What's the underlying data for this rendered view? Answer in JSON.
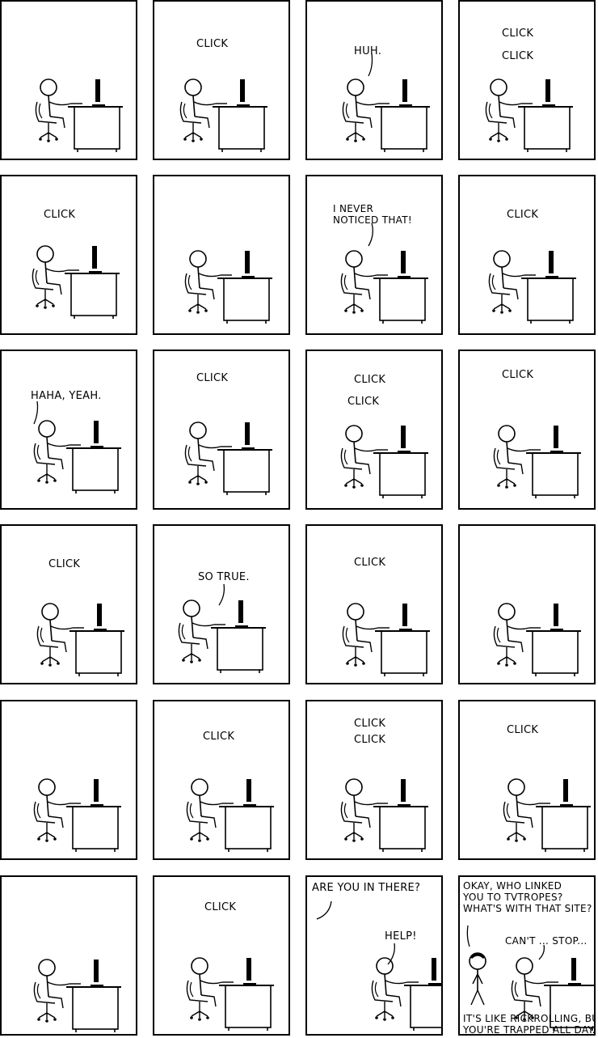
{
  "comic": {
    "panels": [
      {
        "id": 1,
        "lines": []
      },
      {
        "id": 2,
        "lines": [
          "CLICK"
        ]
      },
      {
        "id": 3,
        "lines": [
          "HUH."
        ]
      },
      {
        "id": 4,
        "lines": [
          "CLICK",
          "CLICK"
        ]
      },
      {
        "id": 5,
        "lines": [
          "CLICK"
        ]
      },
      {
        "id": 6,
        "lines": []
      },
      {
        "id": 7,
        "lines": [
          "I NEVER",
          "NOTICED THAT!"
        ]
      },
      {
        "id": 8,
        "lines": [
          "CLICK"
        ]
      },
      {
        "id": 9,
        "lines": [
          "HAHA, YEAH."
        ]
      },
      {
        "id": 10,
        "lines": [
          "CLICK"
        ]
      },
      {
        "id": 11,
        "lines": [
          "CLICK",
          "CLICK"
        ]
      },
      {
        "id": 12,
        "lines": [
          "CLICK"
        ]
      },
      {
        "id": 13,
        "lines": [
          "CLICK"
        ]
      },
      {
        "id": 14,
        "lines": [
          "SO TRUE."
        ]
      },
      {
        "id": 15,
        "lines": [
          "CLICK"
        ]
      },
      {
        "id": 16,
        "lines": []
      },
      {
        "id": 17,
        "lines": []
      },
      {
        "id": 18,
        "lines": [
          "CLICK"
        ]
      },
      {
        "id": 19,
        "lines": [
          "CLICK",
          "CLICK"
        ]
      },
      {
        "id": 20,
        "lines": [
          "CLICK"
        ]
      },
      {
        "id": 21,
        "lines": []
      },
      {
        "id": 22,
        "lines": [
          "CLICK"
        ]
      },
      {
        "id": 23,
        "lines": [
          "ARE YOU IN THERE?",
          "HELP!"
        ]
      },
      {
        "id": 24,
        "lines": [
          "OKAY, WHO LINKED",
          "YOU TO TVTROPES?",
          "WHAT'S WITH THAT SITE?",
          "CAN'T ... STOP...",
          "IT'S LIKE RICKROLLING, BUT",
          "YOU'RE TRAPPED ALL DAY."
        ]
      }
    ]
  }
}
